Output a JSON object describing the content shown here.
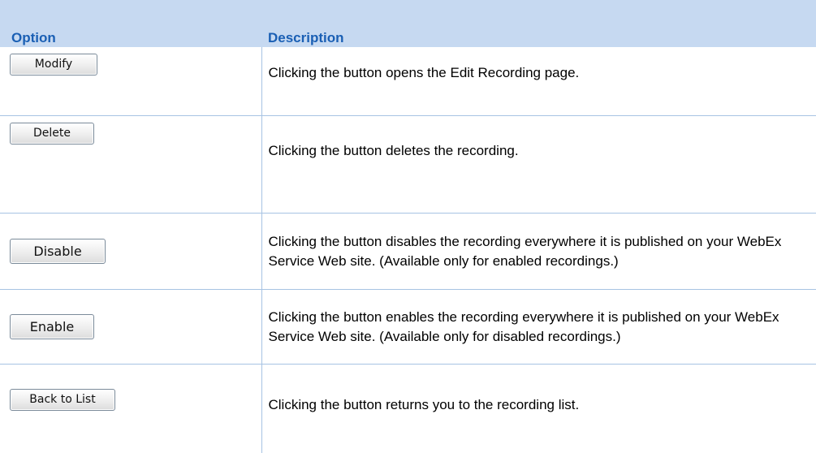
{
  "header": {
    "option": "Option",
    "description": "Description"
  },
  "rows": [
    {
      "button": "Modify",
      "description": "Clicking the button opens the Edit Recording page."
    },
    {
      "button": "Delete",
      "description": "Clicking the button deletes the recording."
    },
    {
      "button": "Disable",
      "description": "Clicking the button disables the recording everywhere it is published on your WebEx Service Web site. (Available only for enabled recordings.)"
    },
    {
      "button": "Enable",
      "description": "Clicking the button enables the recording everywhere it is published on your WebEx Service Web site. (Available only for disabled recordings.)"
    },
    {
      "button": "Back to List",
      "description": "Clicking the button returns you to the recording list."
    }
  ],
  "colors": {
    "header_background": "#c6d9f1",
    "header_text": "#1a5fb4",
    "rule": "#a7c3e3"
  }
}
